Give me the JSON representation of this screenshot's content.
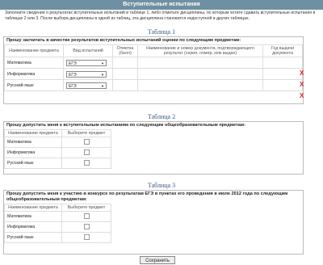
{
  "header": {
    "title": "Вступительные испытания"
  },
  "intro": "Заполните сведения о результатах вступительных испытаний в таблице 1, либо отметьте дисциплины, по которым хотите сдавать вступительные испытания в таблицах 2 или 3. После выбора дисциплины в одной из таблиц, эта дисциплина становится недоступной в других таблицах.",
  "table1": {
    "caption": "Таблица 1",
    "title": "Прошу засчитать в качестве результатов вступительных испытаний оценки по следующим предметам:",
    "headers": [
      "Наименование предмета",
      "Вид испытаний",
      "Отметка (балл)",
      "Наименование и номер документа, подтверждающего результат (серия, номер, кем выдан)",
      "Год выдачи документа"
    ],
    "rows": [
      {
        "subject": "Математика",
        "type": "ЕГЭ"
      },
      {
        "subject": "Информатика",
        "type": "ЕГЭ"
      },
      {
        "subject": "Русский язык",
        "type": "ЕГЭ"
      }
    ],
    "remove": "X"
  },
  "table2": {
    "caption": "Таблица 2",
    "title": "Прошу допустить меня к вступительным испытаниям по следующим общеобразовательным предметам:",
    "headers": [
      "Наименование предмета",
      "Выберите предмет"
    ],
    "rows": [
      "Математика",
      "Информатика",
      "Русский язык"
    ]
  },
  "table3": {
    "caption": "Таблица 3",
    "title": "Прошу допустить меня к участию в конкурсе по результатам ЕГЭ в пунктах его проведения в июле 2012 года по следующим общеобразовательным предметам:",
    "headers": [
      "Наименование предмета",
      "Выберите предмет"
    ],
    "rows": [
      "Математика",
      "Информатика",
      "Русский язык"
    ]
  },
  "save_label": "Сохранить"
}
